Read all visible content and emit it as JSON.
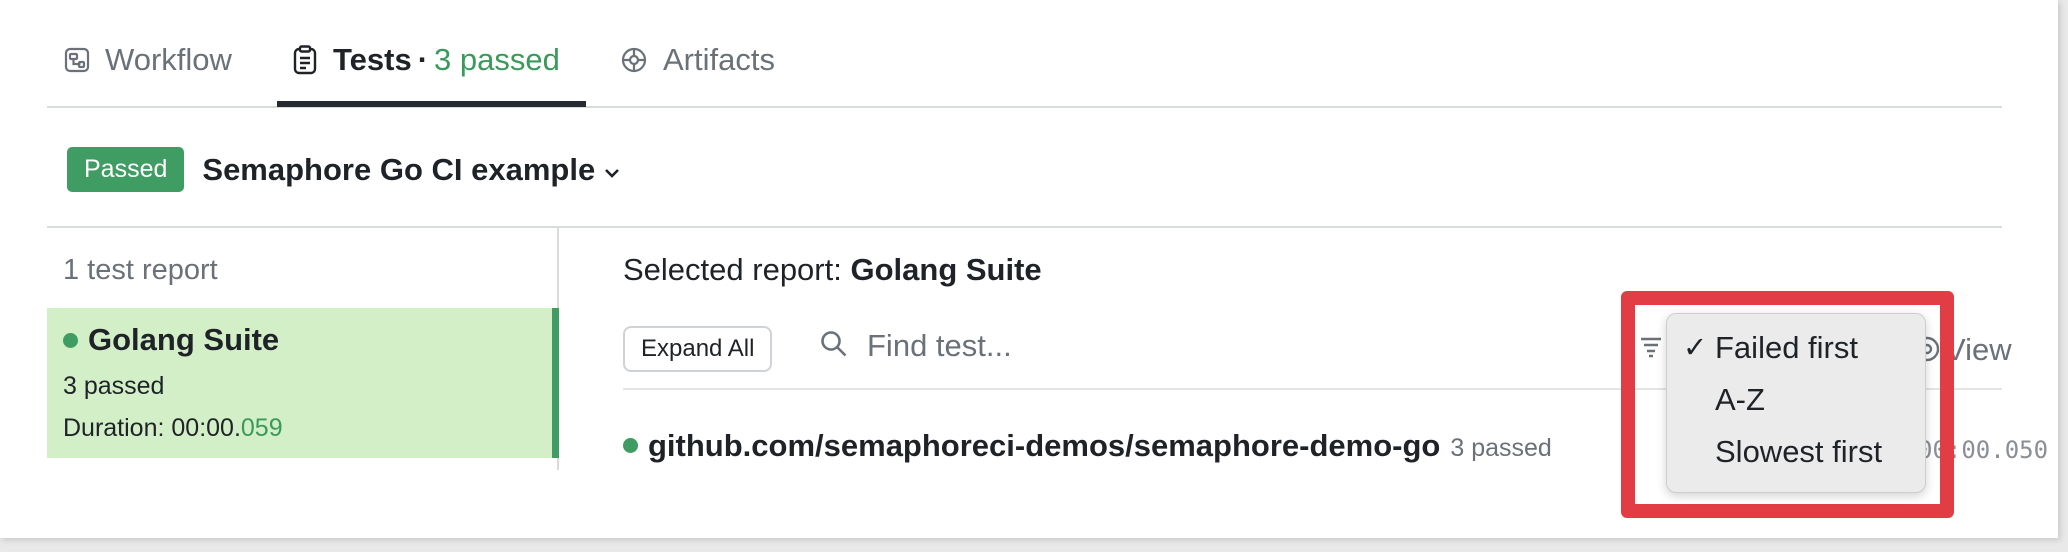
{
  "tabs": [
    {
      "label": "Workflow",
      "icon": "workflow-icon"
    },
    {
      "label": "Tests",
      "separator": "·",
      "count": "3 passed",
      "icon": "clipboard-icon",
      "active": true
    },
    {
      "label": "Artifacts",
      "icon": "artifacts-icon"
    }
  ],
  "pipeline": {
    "status_badge": "Passed",
    "title": "Semaphore Go CI example",
    "status_color": "#3f9c63"
  },
  "sidebar": {
    "heading": "1 test report",
    "report": {
      "name": "Golang Suite",
      "passed": "3 passed",
      "duration_label": "Duration: 00:00.",
      "duration_ms": "059"
    }
  },
  "main": {
    "selected_label": "Selected report:",
    "selected_name": "Golang Suite",
    "expand_button": "Expand All",
    "search_placeholder": "Find test...",
    "view_label": "View",
    "suite": {
      "name": "github.com/semaphoreci-demos/semaphore-demo-go",
      "passed": "3 passed",
      "duration": "00:00.050"
    }
  },
  "sort_menu": {
    "checkmark": "✓",
    "options": [
      "Failed first",
      "A-Z",
      "Slowest first"
    ],
    "selected": "Failed first"
  },
  "highlight_color": "#e23c44"
}
